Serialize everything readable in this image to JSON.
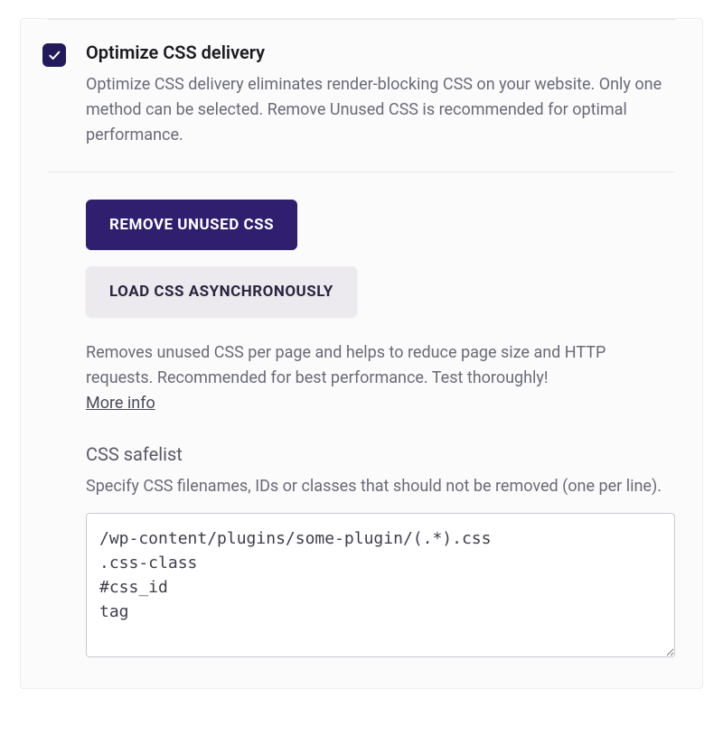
{
  "option": {
    "title": "Optimize CSS delivery",
    "description": "Optimize CSS delivery eliminates render-blocking CSS on your website. Only one method can be selected. Remove Unused CSS is recommended for optimal performance.",
    "checked": true
  },
  "buttons": {
    "remove_unused_css": "Remove Unused CSS",
    "load_async": "Load CSS Asynchronously"
  },
  "remove_unused": {
    "description": "Removes unused CSS per page and helps to reduce page size and HTTP requests. Recommended for best performance. Test thoroughly!",
    "more_info_label": "More info"
  },
  "safelist": {
    "heading": "CSS safelist",
    "description": "Specify CSS filenames, IDs or classes that should not be removed (one per line).",
    "value": "/wp-content/plugins/some-plugin/(.*).css\n.css-class\n#css_id\ntag"
  }
}
